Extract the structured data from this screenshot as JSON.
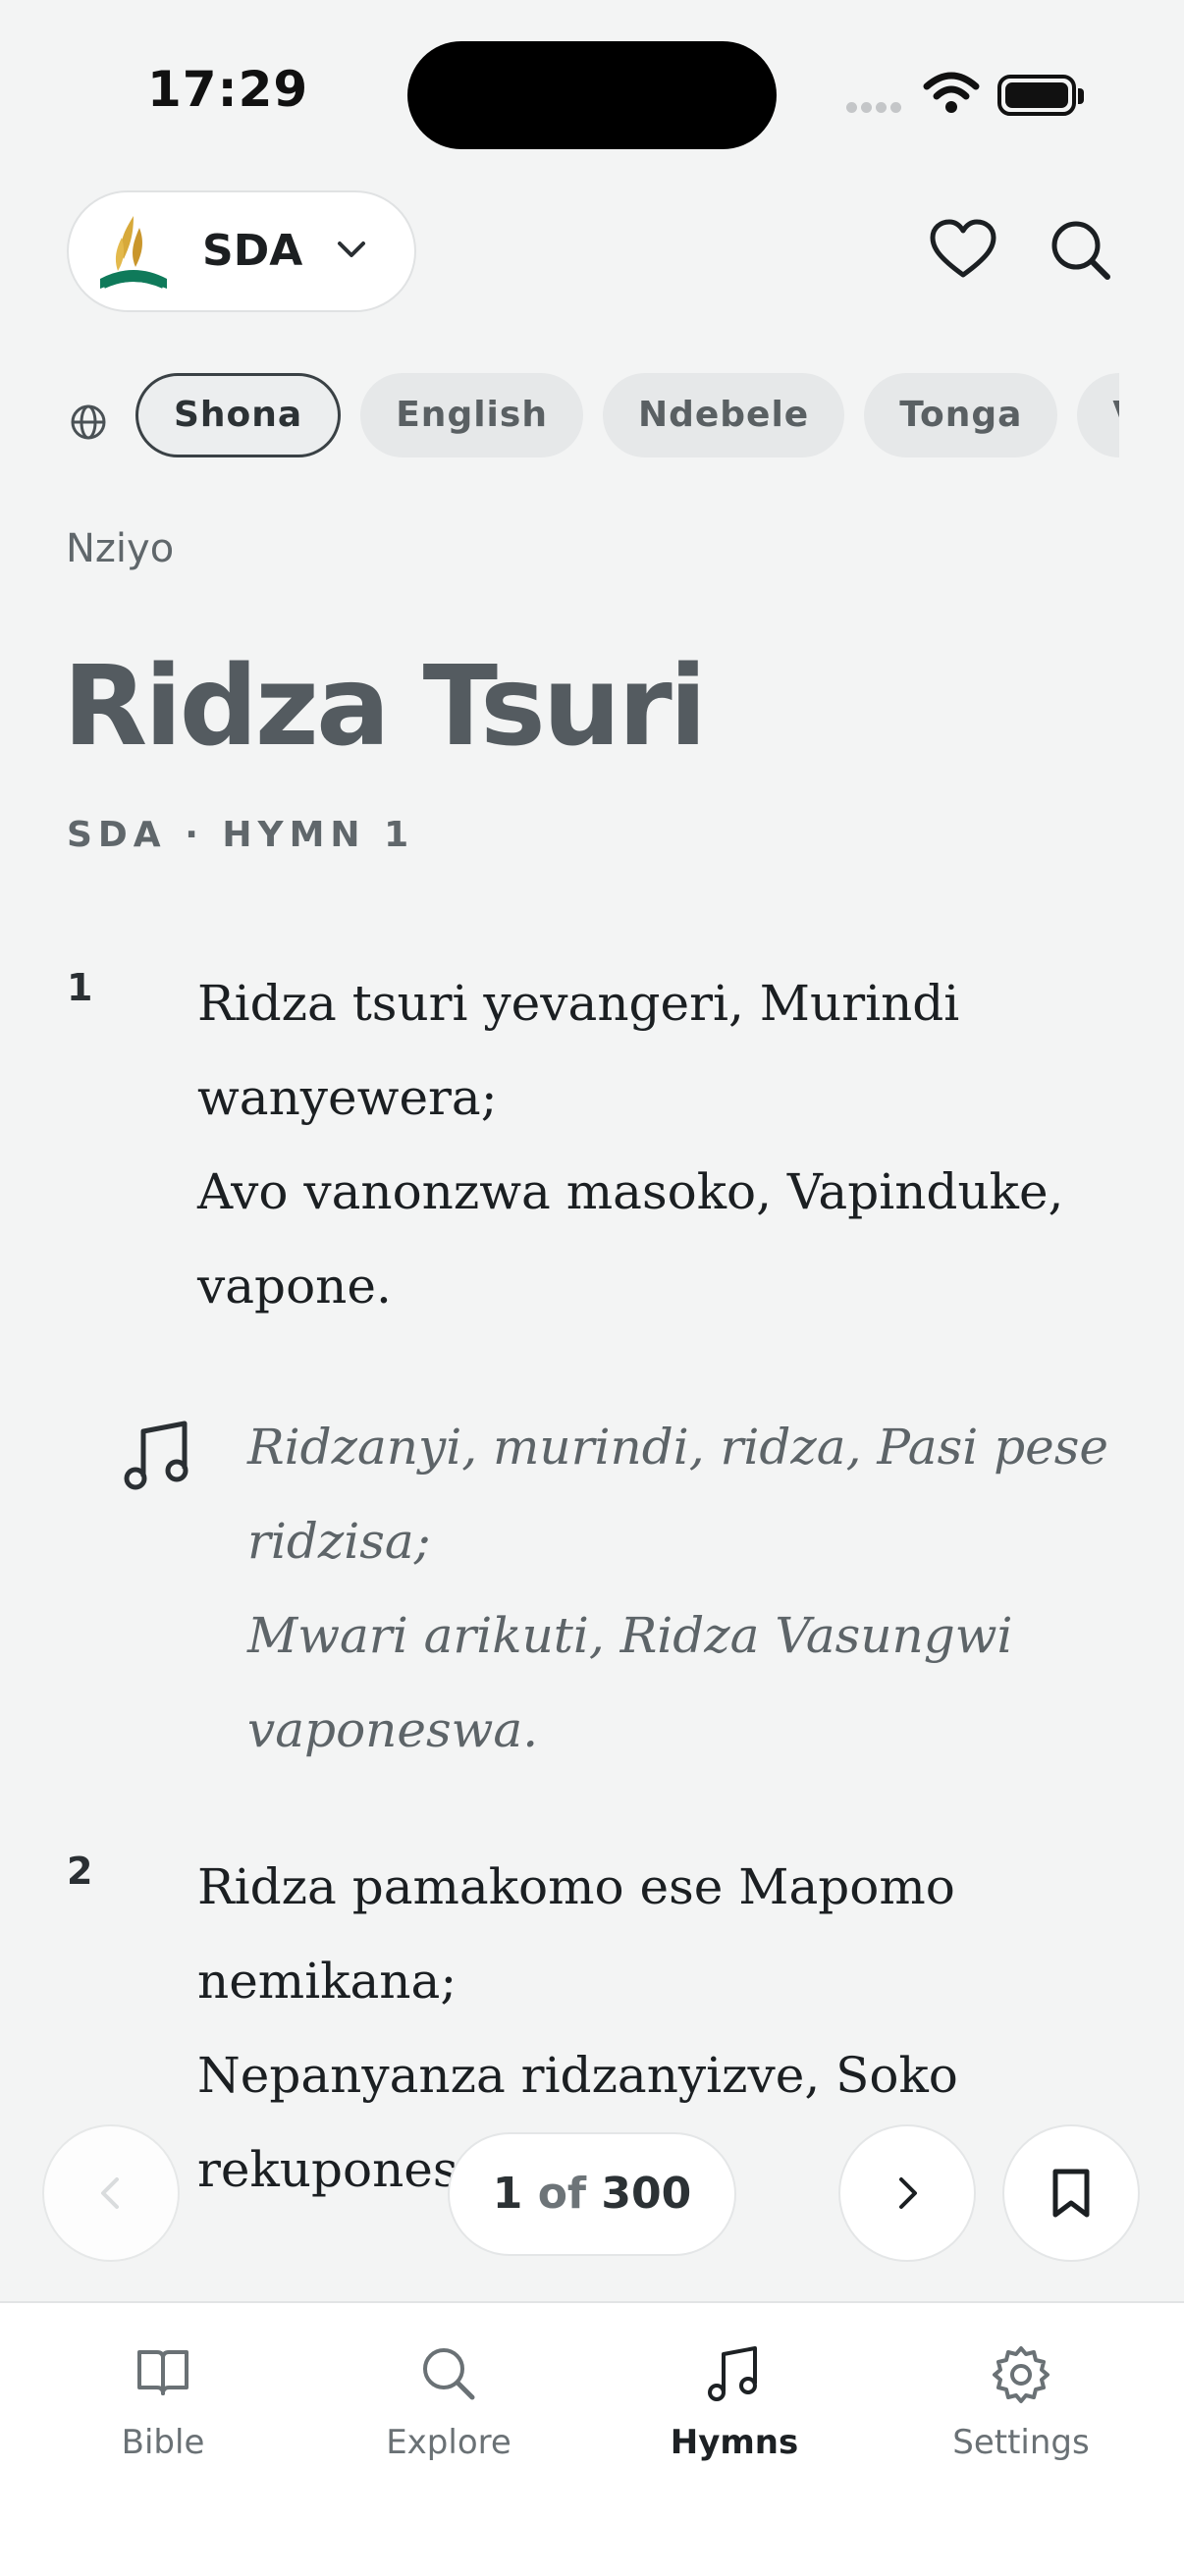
{
  "status_bar": {
    "time": "17:29"
  },
  "header": {
    "hymnal": {
      "name": "SDA",
      "logo_icon": "sda-flame-logo-icon"
    },
    "favorites_icon": "heart-icon",
    "search_icon": "search-icon"
  },
  "languages": {
    "icon": "globe-icon",
    "chips": [
      "Shona",
      "English",
      "Ndebele",
      "Tonga",
      "Venda"
    ],
    "selected": "Shona"
  },
  "hymn": {
    "section": "Nziyo",
    "title": "Ridza Tsuri",
    "meta": "SDA · HYMN 1",
    "verses": [
      {
        "number": "1",
        "lines": [
          "Ridza tsuri yevangeri, Murindi",
          "wanyewera;",
          "Avo vanonzwa masoko, Vapinduke,",
          "vapone."
        ]
      },
      {
        "number": "2",
        "lines": [
          "Ridza pamakomo ese Mapomo",
          "nemikana;",
          "Nepanyanza ridzanyizve, Soko",
          "rekuponeswa."
        ]
      }
    ],
    "chorus": {
      "icon": "music-note-icon",
      "lines": [
        "Ridzanyi, murindi, ridza, Pasi pese",
        "ridzisa;",
        "Mwari arikuti, Ridza Vasungwi",
        "vaponeswa."
      ]
    }
  },
  "pager": {
    "current": "1",
    "of_label": "of",
    "total": "300",
    "prev_icon": "chevron-left-icon",
    "next_icon": "chevron-right-icon",
    "bookmark_icon": "bookmark-icon"
  },
  "tabs": [
    {
      "label": "Bible",
      "icon": "book-icon",
      "active": false
    },
    {
      "label": "Explore",
      "icon": "search-icon",
      "active": false
    },
    {
      "label": "Hymns",
      "icon": "music-note-icon",
      "active": true
    },
    {
      "label": "Settings",
      "icon": "gear-icon",
      "active": false
    }
  ],
  "colors": {
    "background": "#f3f4f4",
    "title": "#545b60",
    "chorus": "#5d6468",
    "text": "#1b1f22"
  }
}
